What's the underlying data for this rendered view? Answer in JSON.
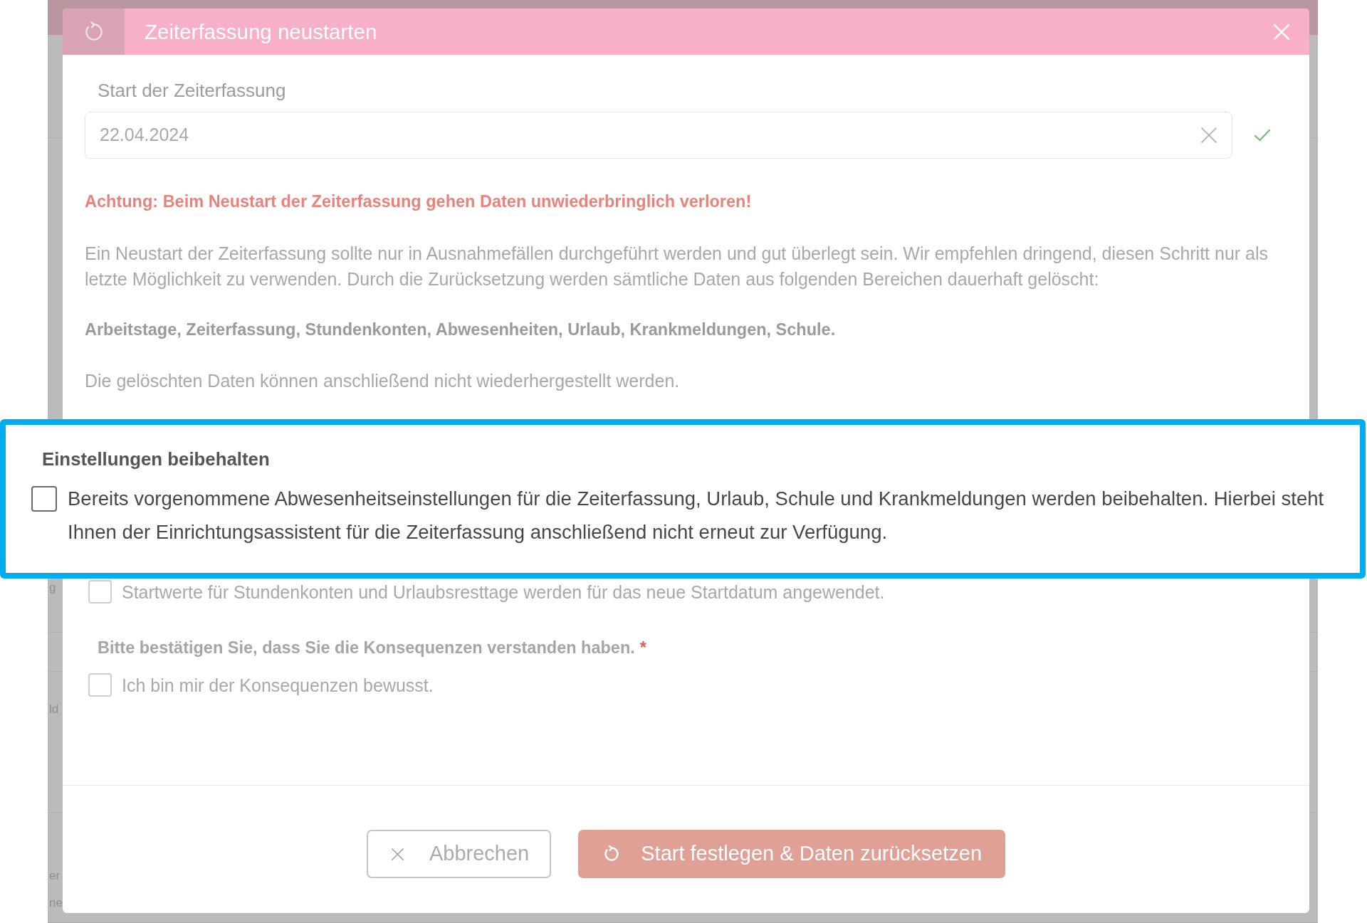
{
  "background_fragments": [
    "g",
    "ld",
    "er",
    "ne"
  ],
  "dialog": {
    "title": "Zeiterfassung neustarten",
    "start_date": {
      "label": "Start der Zeiterfassung",
      "value": "22.04.2024",
      "valid": true
    },
    "warning": "Achtung: Beim Neustart der Zeiterfassung gehen Daten unwiederbringlich verloren!",
    "description": "Ein Neustart der Zeiterfassung sollte nur in Ausnahmefällen durchgeführt werden und gut überlegt sein. Wir empfehlen dringend, diesen Schritt nur als letzte Möglichkeit zu verwenden. Durch die Zurücksetzung werden sämtliche Daten aus folgenden Bereichen dauerhaft gelöscht:",
    "affected_areas": "Arbeitstage, Zeiterfassung, Stundenkonten, Abwesenheiten, Urlaub, Krankmeldungen, Schule.",
    "note": "Die gelöschten Daten können anschließend nicht wiederhergestellt werden.",
    "options": [
      {
        "label": "Startwerte für Stundenkonten und Urlaubsresttage werden für das neue Startdatum angewendet.",
        "checked": false
      }
    ],
    "confirmation": {
      "label": "Bitte bestätigen Sie, dass Sie die Konsequenzen verstanden haben.",
      "required_mark": "*",
      "checkbox": {
        "label": "Ich bin mir der Konsequenzen bewusst.",
        "checked": false
      }
    },
    "buttons": [
      {
        "kind": "cancel",
        "label": "Abbrechen"
      },
      {
        "kind": "confirm",
        "label": "Start festlegen & Daten zurücksetzen"
      }
    ]
  },
  "highlight": {
    "title": "Einstellungen beibehalten",
    "option": {
      "label": "Bereits vorgenommene Abwesenheitseinstellungen für die Zeiterfassung, Urlaub, Schule und Krankmeldungen werden beibehalten. Hierbei steht Ihnen der Einrichtungsassistent für die Zeiterfassung anschließend nicht erneut zur Verfügung.",
      "checked": false
    }
  }
}
